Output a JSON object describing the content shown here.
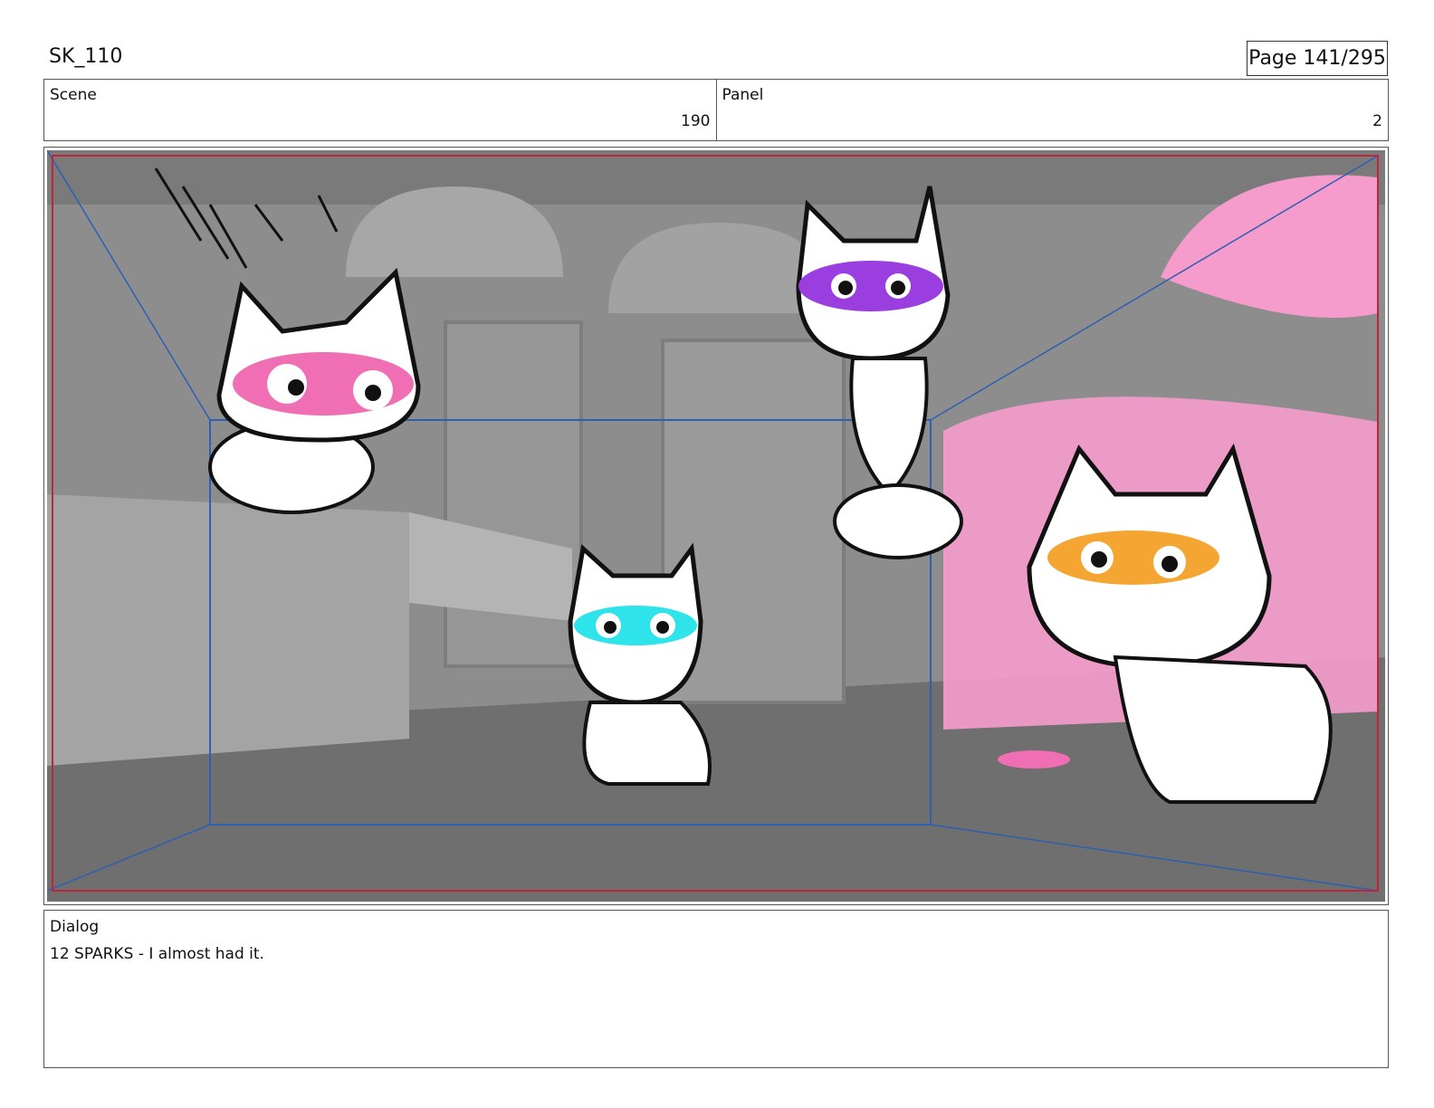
{
  "header": {
    "title": "SK_110",
    "page": "Page 141/295"
  },
  "info": {
    "scene_label": "Scene",
    "scene_value": "190",
    "panel_label": "Panel",
    "panel_value": "2"
  },
  "panel_image": {
    "description_icon": "storyboard-frame",
    "accent_colors": {
      "frame_border": "#c0243a",
      "camera_guide": "#2f5fb0",
      "pink_mask": "#f06fb4",
      "purple_mask": "#9b3ee0",
      "cyan_mask": "#2ee3ea",
      "orange_mask": "#f5a531",
      "pink_prop": "#f59ccc"
    }
  },
  "dialog": {
    "label": "Dialog",
    "text": "12 SPARKS - I almost had it."
  }
}
